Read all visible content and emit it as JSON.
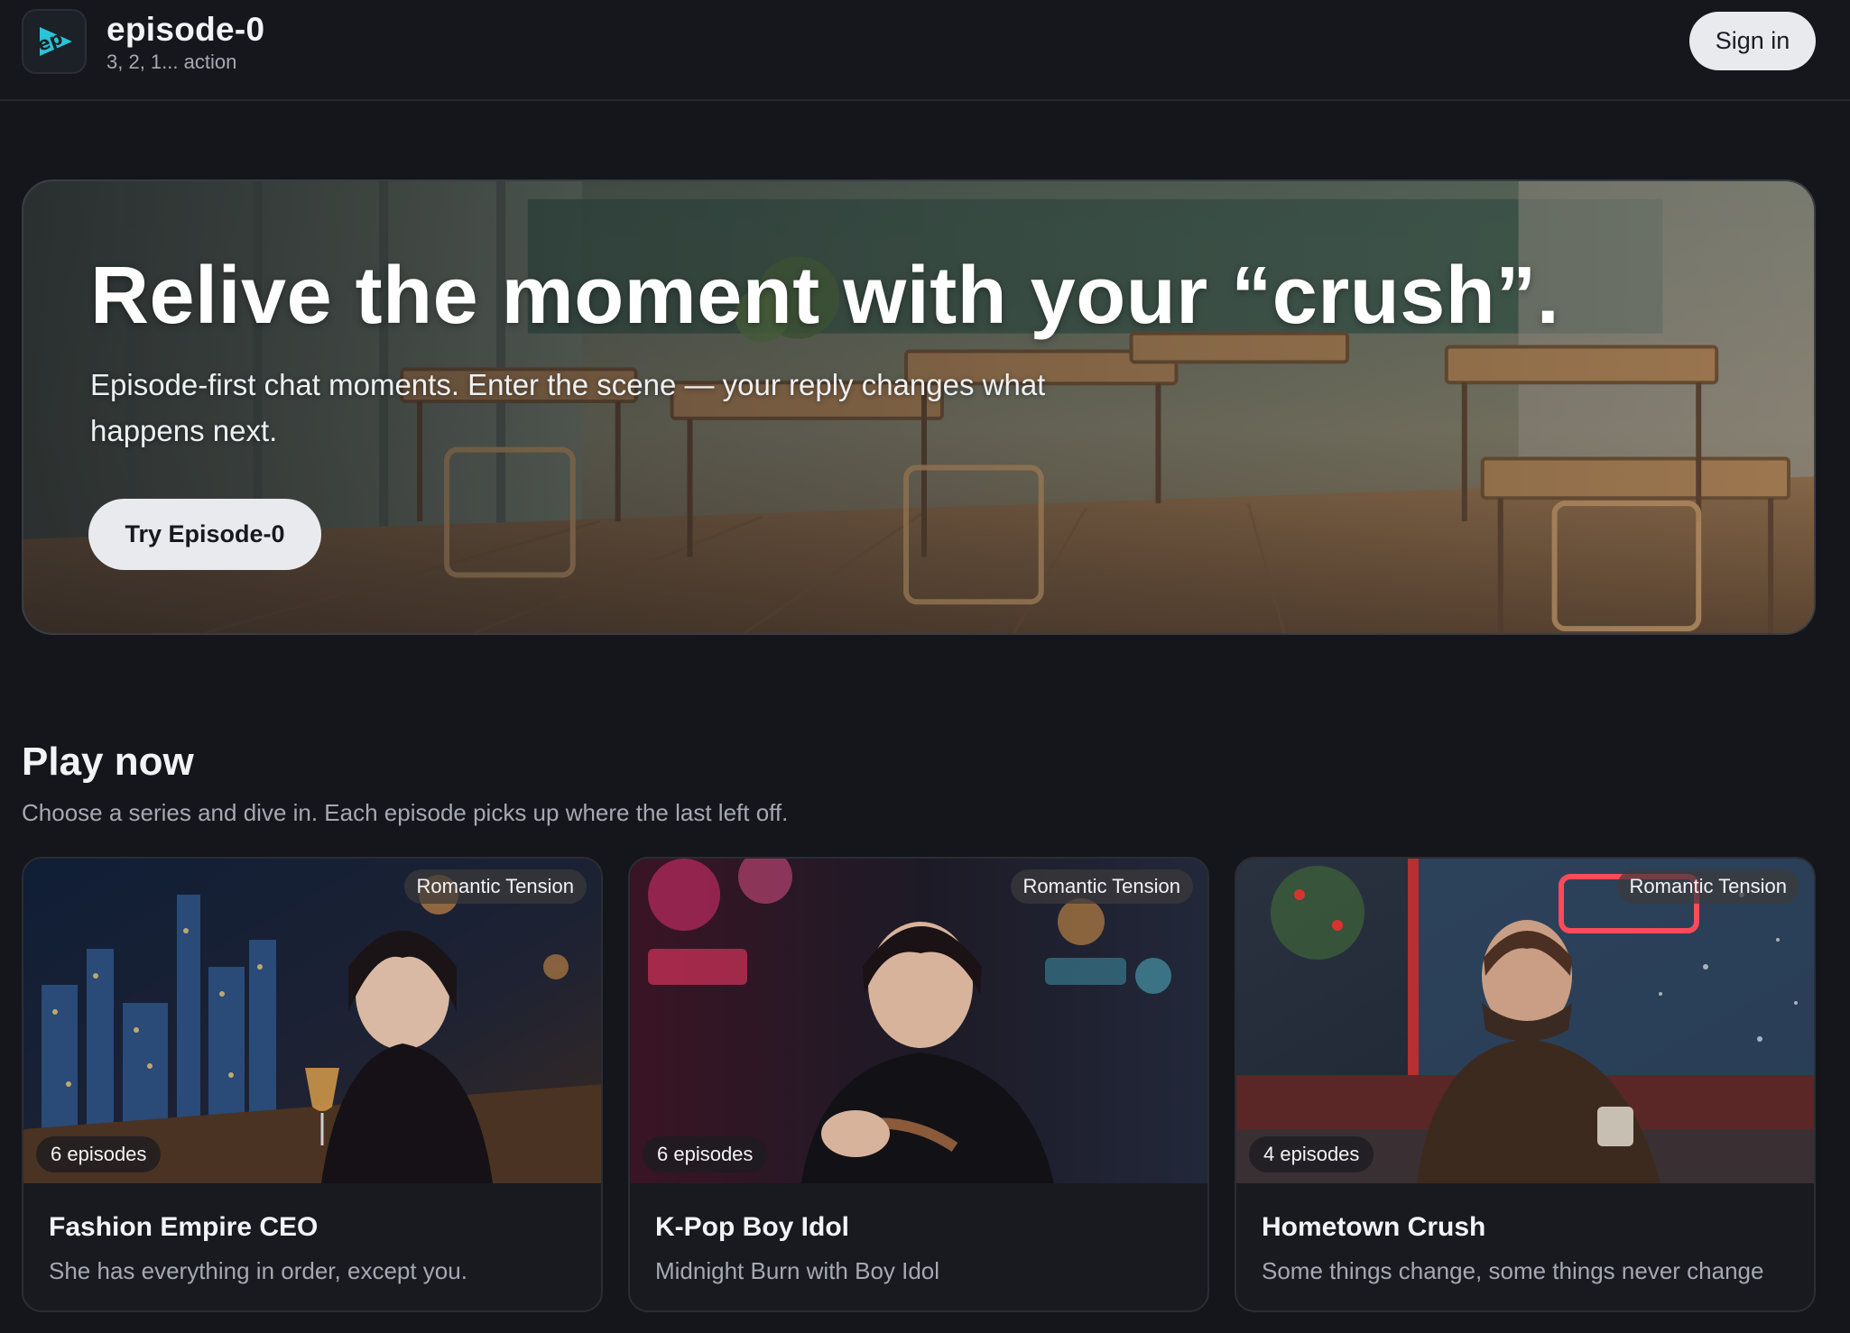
{
  "header": {
    "brand_name": "episode-0",
    "tagline": "3, 2, 1... action",
    "signin_label": "Sign in",
    "accent_color": "#29c4d6"
  },
  "hero": {
    "title": "Relive the moment with your “crush”.",
    "subtitle": "Episode-first chat moments. Enter the scene — your reply changes what happens next.",
    "cta_label": "Try Episode-0"
  },
  "play_now": {
    "title": "Play now",
    "subtitle": "Choose a series and dive in. Each episode picks up where the last left off.",
    "cards": [
      {
        "title": "Fashion Empire CEO",
        "description": "She has everything in order, except you.",
        "tag": "Romantic Tension",
        "episodes": "6 episodes"
      },
      {
        "title": "K-Pop Boy Idol",
        "description": "Midnight Burn with Boy Idol",
        "tag": "Romantic Tension",
        "episodes": "6 episodes"
      },
      {
        "title": "Hometown Crush",
        "description": "Some things change, some things never change",
        "tag": "Romantic Tension",
        "episodes": "4 episodes"
      }
    ]
  }
}
